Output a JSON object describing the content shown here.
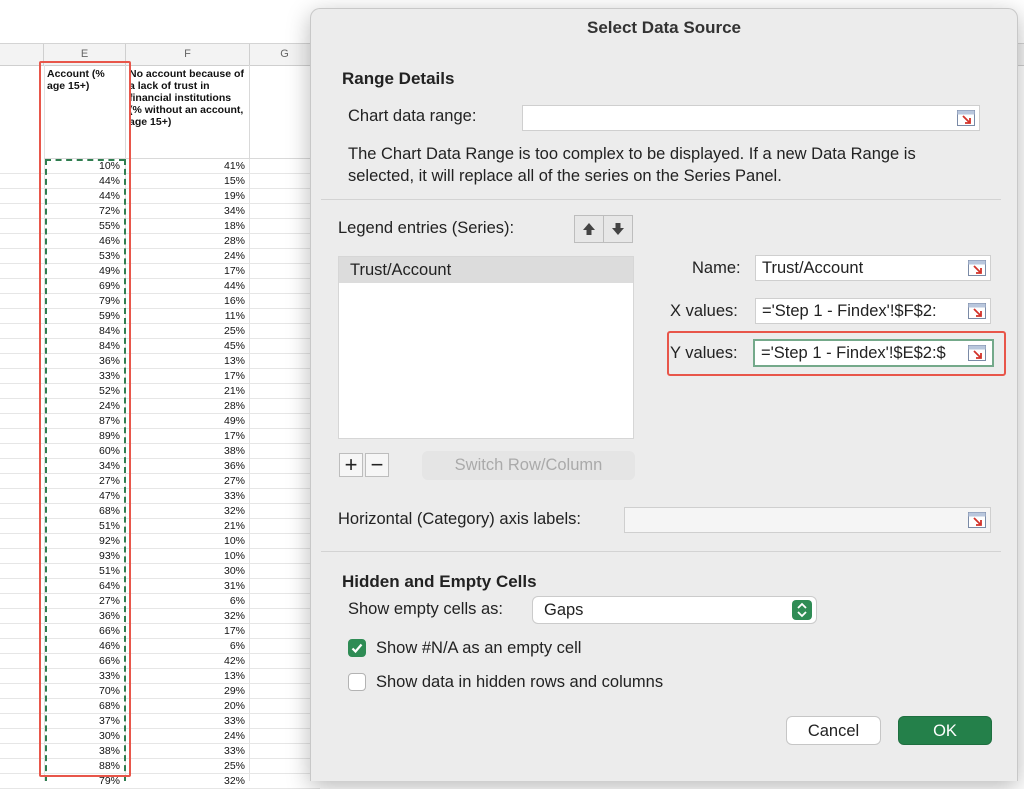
{
  "sheet": {
    "columns": [
      "E",
      "F",
      "G"
    ],
    "header_e": "Account (% age 15+)",
    "header_f": "No account because of a lack of trust in financial institutions (% without an account, age 15+)",
    "rows": [
      [
        "10%",
        "41%"
      ],
      [
        "44%",
        "15%"
      ],
      [
        "44%",
        "19%"
      ],
      [
        "72%",
        "34%"
      ],
      [
        "55%",
        "18%"
      ],
      [
        "46%",
        "28%"
      ],
      [
        "53%",
        "24%"
      ],
      [
        "49%",
        "17%"
      ],
      [
        "69%",
        "44%"
      ],
      [
        "79%",
        "16%"
      ],
      [
        "59%",
        "11%"
      ],
      [
        "84%",
        "25%"
      ],
      [
        "84%",
        "45%"
      ],
      [
        "36%",
        "13%"
      ],
      [
        "33%",
        "17%"
      ],
      [
        "52%",
        "21%"
      ],
      [
        "24%",
        "28%"
      ],
      [
        "87%",
        "49%"
      ],
      [
        "89%",
        "17%"
      ],
      [
        "60%",
        "38%"
      ],
      [
        "34%",
        "36%"
      ],
      [
        "27%",
        "27%"
      ],
      [
        "47%",
        "33%"
      ],
      [
        "68%",
        "32%"
      ],
      [
        "51%",
        "21%"
      ],
      [
        "92%",
        "10%"
      ],
      [
        "93%",
        "10%"
      ],
      [
        "51%",
        "30%"
      ],
      [
        "64%",
        "31%"
      ],
      [
        "27%",
        "6%"
      ],
      [
        "36%",
        "32%"
      ],
      [
        "66%",
        "17%"
      ],
      [
        "46%",
        "6%"
      ],
      [
        "66%",
        "42%"
      ],
      [
        "33%",
        "13%"
      ],
      [
        "70%",
        "29%"
      ],
      [
        "68%",
        "20%"
      ],
      [
        "37%",
        "33%"
      ],
      [
        "30%",
        "24%"
      ],
      [
        "38%",
        "33%"
      ],
      [
        "88%",
        "25%"
      ],
      [
        "79%",
        "32%"
      ]
    ]
  },
  "dialog": {
    "title": "Select Data Source",
    "range_details_title": "Range Details",
    "chart_data_range_label": "Chart data range:",
    "chart_data_range_value": "",
    "range_message": "The Chart Data Range is too complex to be displayed. If a new Data Range is selected, it will replace all of the series on the Series Panel.",
    "legend_entries_label": "Legend entries (Series):",
    "series": [
      "Trust/Account"
    ],
    "name_label": "Name:",
    "name_value": "Trust/Account",
    "x_values_label": "X values:",
    "x_values_value": "='Step 1 - Findex'!$F$2:",
    "y_values_label": "Y values:",
    "y_values_value": "='Step 1 - Findex'!$E$2:$",
    "add_symbol": "+",
    "remove_symbol": "−",
    "switch_label": "Switch Row/Column",
    "horizontal_axis_label": "Horizontal (Category) axis labels:",
    "horizontal_axis_value": "",
    "hidden_title": "Hidden and Empty Cells",
    "show_empty_label": "Show empty cells as:",
    "show_empty_value": "Gaps",
    "show_na_label": "Show #N/A as an empty cell",
    "show_na_checked": true,
    "show_hidden_label": "Show data in hidden rows and columns",
    "show_hidden_checked": false,
    "cancel_label": "Cancel",
    "ok_label": "OK"
  },
  "colors": {
    "accent_green": "#24804a",
    "highlight_red": "#e8564a",
    "marching_ants": "#2f7d4f"
  }
}
